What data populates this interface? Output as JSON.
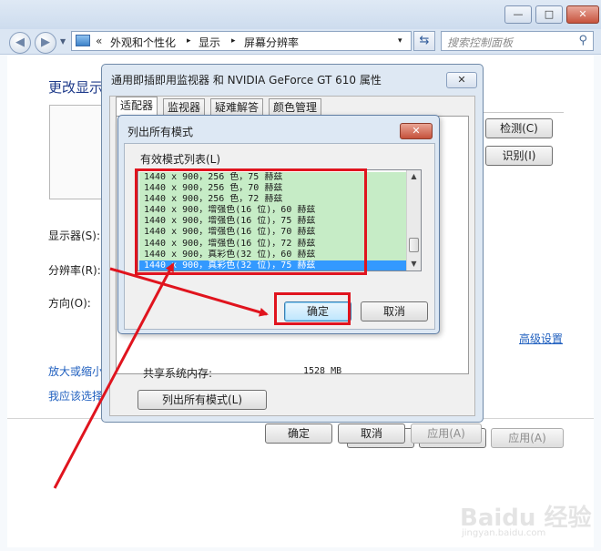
{
  "control_panel": {
    "address": {
      "chevron": "«",
      "parts": [
        "外观和个性化",
        "显示",
        "屏幕分辨率"
      ],
      "separator": "▸",
      "dropdown": "▾"
    },
    "search_placeholder": "搜索控制面板",
    "heading": "更改显示",
    "labels": {
      "display": "显示器(S):",
      "resolution": "分辨率(R):",
      "orientation": "方向(O):"
    },
    "links": {
      "zoom": "放大或缩小",
      "choose": "我应该选择",
      "advanced": "高级设置"
    },
    "buttons": {
      "detect": "检测(C)",
      "identify": "识别(I)",
      "ok": "确定",
      "cancel": "取消",
      "apply": "应用(A)"
    }
  },
  "properties_dialog": {
    "title": "通用即插即用监视器 和 NVIDIA GeForce GT 610 属性",
    "tabs": [
      "适配器",
      "监视器",
      "疑难解答",
      "颜色管理"
    ],
    "shared_memory_label": "共享系统内存:",
    "shared_memory_value": "1528 MB",
    "buttons": {
      "list_modes": "列出所有模式(L)",
      "ok": "确定",
      "cancel": "取消",
      "apply": "应用(A)"
    }
  },
  "modes_dialog": {
    "title": "列出所有模式",
    "list_label": "有效模式列表(L)",
    "modes": [
      "1440 x 900，256 色，75 赫兹",
      "1440 x 900，256 色，70 赫兹",
      "1440 x 900，256 色，72 赫兹",
      "1440 x 900，增强色(16 位)，60 赫兹",
      "1440 x 900，增强色(16 位)，75 赫兹",
      "1440 x 900，增强色(16 位)，70 赫兹",
      "1440 x 900，增强色(16 位)，72 赫兹",
      "1440 x 900，真彩色(32 位)，60 赫兹",
      "1440 x 900，真彩色(32 位)，75 赫兹"
    ],
    "selected_index": 8,
    "buttons": {
      "ok": "确定",
      "cancel": "取消"
    }
  },
  "watermark": {
    "logo": "Baidu 经验",
    "url": "jingyan.baidu.com"
  },
  "colors": {
    "annotation": "#e0141e",
    "list_background": "#c6ecc6",
    "selection": "#3399ff",
    "link": "#1f5fbf"
  }
}
